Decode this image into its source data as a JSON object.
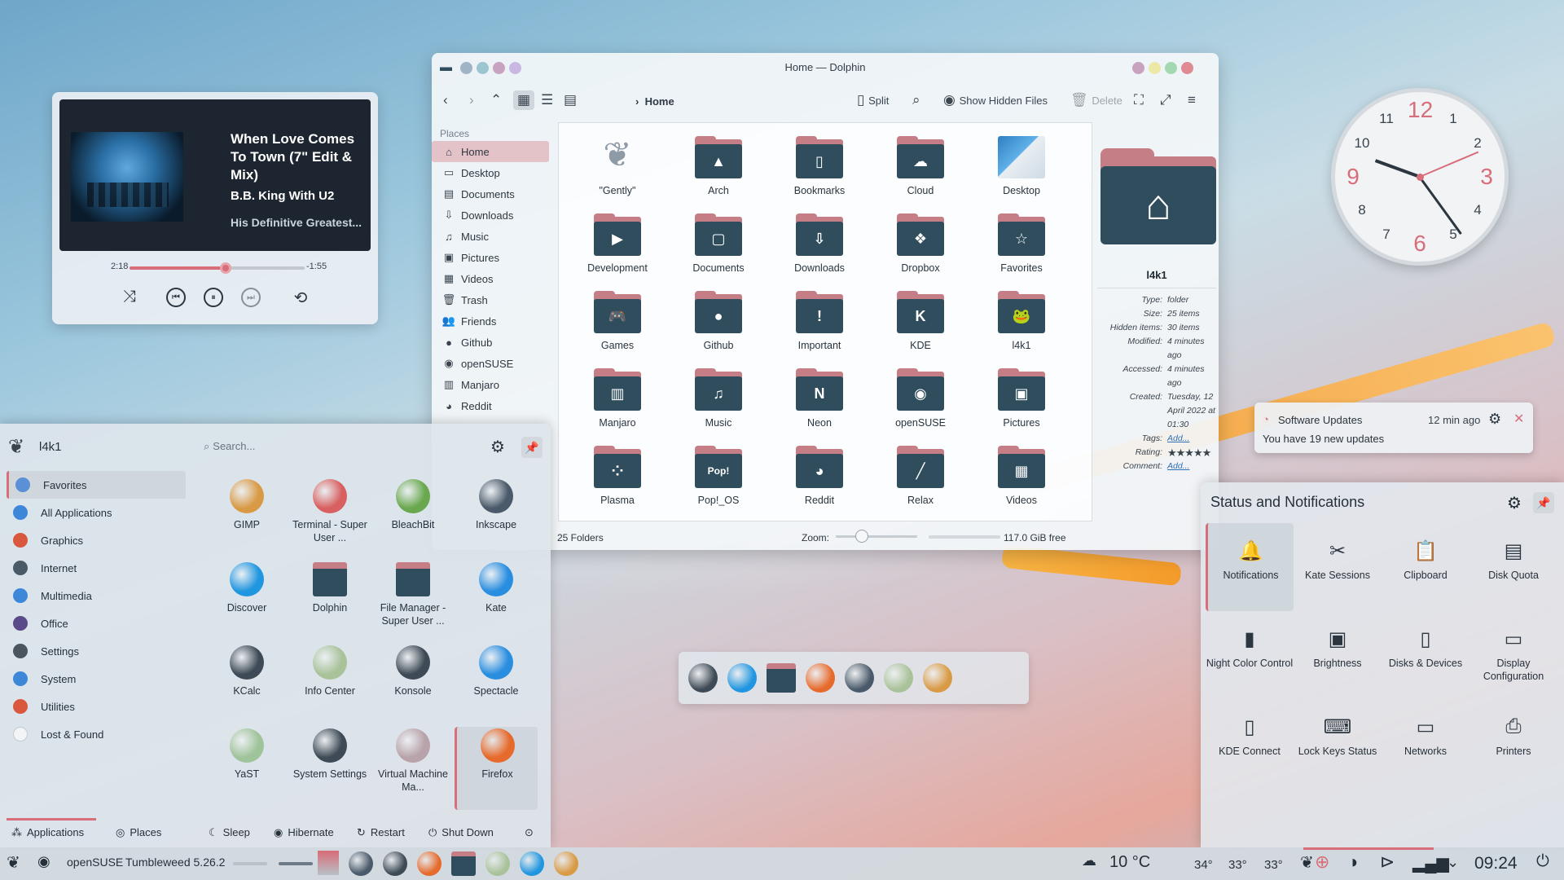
{
  "media": {
    "title": "When Love Comes To Town (7\" Edit & Mix)",
    "artist": "B.B. King With U2",
    "album": "His Definitive Greatest...",
    "elapsed": "2:18",
    "remaining": "-1:55",
    "progress_fraction": 0.55,
    "controls": [
      "shuffle",
      "previous",
      "pause",
      "next",
      "repeat"
    ]
  },
  "dolphin": {
    "window_title": "Home — Dolphin",
    "breadcrumb": "Home",
    "toolbar": {
      "split": "Split",
      "show_hidden": "Show Hidden Files",
      "delete": "Delete"
    },
    "places_header": "Places",
    "places": [
      {
        "label": "Home",
        "icon": "home-icon",
        "glyph": "⌂"
      },
      {
        "label": "Desktop",
        "icon": "desktop-icon",
        "glyph": "▭"
      },
      {
        "label": "Documents",
        "icon": "documents-icon",
        "glyph": "▤"
      },
      {
        "label": "Downloads",
        "icon": "downloads-icon",
        "glyph": "⇩"
      },
      {
        "label": "Music",
        "icon": "music-icon",
        "glyph": "♫"
      },
      {
        "label": "Pictures",
        "icon": "pictures-icon",
        "glyph": "▣"
      },
      {
        "label": "Videos",
        "icon": "videos-icon",
        "glyph": "▦"
      },
      {
        "label": "Trash",
        "icon": "trash-icon",
        "glyph": "🗑"
      },
      {
        "label": "Friends",
        "icon": "friends-icon",
        "glyph": "👥"
      },
      {
        "label": "Github",
        "icon": "github-icon",
        "glyph": "●"
      },
      {
        "label": "openSUSE",
        "icon": "opensuse-icon",
        "glyph": "◉"
      },
      {
        "label": "Manjaro",
        "icon": "manjaro-icon",
        "glyph": "▥"
      },
      {
        "label": "Reddit",
        "icon": "reddit-icon",
        "glyph": "◕"
      }
    ],
    "files": [
      {
        "label": "\"Gently\"",
        "icon": "gently-logo-icon",
        "glyph": "❦",
        "kind": "logo"
      },
      {
        "label": "Arch",
        "icon": "arch-folder-icon",
        "glyph": "▲"
      },
      {
        "label": "Bookmarks",
        "icon": "bookmarks-folder-icon",
        "glyph": "▯"
      },
      {
        "label": "Cloud",
        "icon": "cloud-folder-icon",
        "glyph": "☁"
      },
      {
        "label": "Desktop",
        "icon": "desktop-folder-icon",
        "glyph": "",
        "kind": "desktop"
      },
      {
        "label": "Development",
        "icon": "development-folder-icon",
        "glyph": "▶"
      },
      {
        "label": "Documents",
        "icon": "documents-folder-icon",
        "glyph": "▢"
      },
      {
        "label": "Downloads",
        "icon": "downloads-folder-icon",
        "glyph": "⇩"
      },
      {
        "label": "Dropbox",
        "icon": "dropbox-folder-icon",
        "glyph": "❖"
      },
      {
        "label": "Favorites",
        "icon": "favorites-folder-icon",
        "glyph": "☆"
      },
      {
        "label": "Games",
        "icon": "games-folder-icon",
        "glyph": "🎮"
      },
      {
        "label": "Github",
        "icon": "github-folder-icon",
        "glyph": "●"
      },
      {
        "label": "Important",
        "icon": "important-folder-icon",
        "glyph": "!"
      },
      {
        "label": "KDE",
        "icon": "kde-folder-icon",
        "glyph": "K"
      },
      {
        "label": "l4k1",
        "icon": "l4k1-folder-icon",
        "glyph": "🐸"
      },
      {
        "label": "Manjaro",
        "icon": "manjaro-folder-icon",
        "glyph": "▥"
      },
      {
        "label": "Music",
        "icon": "music-folder-icon",
        "glyph": "♫"
      },
      {
        "label": "Neon",
        "icon": "neon-folder-icon",
        "glyph": "N"
      },
      {
        "label": "openSUSE",
        "icon": "opensuse-folder-icon",
        "glyph": "◉"
      },
      {
        "label": "Pictures",
        "icon": "pictures-folder-icon",
        "glyph": "▣"
      },
      {
        "label": "Plasma",
        "icon": "plasma-folder-icon",
        "glyph": "⁘"
      },
      {
        "label": "Pop!_OS",
        "icon": "popos-folder-icon",
        "glyph": "Pop!"
      },
      {
        "label": "Reddit",
        "icon": "reddit-folder-icon",
        "glyph": "◕"
      },
      {
        "label": "Relax",
        "icon": "relax-folder-icon",
        "glyph": "╱"
      },
      {
        "label": "Videos",
        "icon": "videos-folder-icon",
        "glyph": "▦"
      }
    ],
    "info": {
      "name": "l4k1",
      "rows": [
        {
          "k": "Type:",
          "v": "folder"
        },
        {
          "k": "Size:",
          "v": "25 items"
        },
        {
          "k": "Hidden items:",
          "v": "30 items"
        },
        {
          "k": "Modified:",
          "v": "4 minutes ago"
        },
        {
          "k": "Accessed:",
          "v": "4 minutes ago"
        },
        {
          "k": "Created:",
          "v": "Tuesday, 12 April 2022 at 01:30"
        },
        {
          "k": "Tags:",
          "v": "Add...",
          "link": true
        },
        {
          "k": "Rating:",
          "v": "★★★★★",
          "stars": true
        },
        {
          "k": "Comment:",
          "v": "Add...",
          "link": true
        }
      ]
    },
    "status": {
      "count": "25 Folders",
      "zoom_label": "Zoom:",
      "free": "117.0 GiB free"
    }
  },
  "clock": {
    "numbers": [
      "12",
      "1",
      "2",
      "3",
      "4",
      "5",
      "6",
      "7",
      "8",
      "9",
      "10",
      "11"
    ]
  },
  "notification": {
    "title": "Software Updates",
    "time_ago": "12 min ago",
    "body": "You have 19 new updates"
  },
  "tray": {
    "title": "Status and Notifications",
    "items": [
      {
        "label": "Notifications",
        "icon": "bell-icon",
        "glyph": "🔔",
        "selected": true
      },
      {
        "label": "Kate Sessions",
        "icon": "kate-icon",
        "glyph": "✂"
      },
      {
        "label": "Clipboard",
        "icon": "clipboard-icon",
        "glyph": "📋"
      },
      {
        "label": "Disk Quota",
        "icon": "disk-quota-icon",
        "glyph": "▤"
      },
      {
        "label": "Night Color Control",
        "icon": "night-color-icon",
        "glyph": "▮"
      },
      {
        "label": "Brightness",
        "icon": "brightness-icon",
        "glyph": "▣"
      },
      {
        "label": "Disks & Devices",
        "icon": "disks-icon",
        "glyph": "▯"
      },
      {
        "label": "Display Configuration",
        "icon": "display-icon",
        "glyph": "▭"
      },
      {
        "label": "KDE Connect",
        "icon": "kde-connect-icon",
        "glyph": "▯"
      },
      {
        "label": "Lock Keys Status",
        "icon": "keyboard-icon",
        "glyph": "⌨"
      },
      {
        "label": "Networks",
        "icon": "network-icon",
        "glyph": "▭"
      },
      {
        "label": "Printers",
        "icon": "printer-icon",
        "glyph": "⎙"
      }
    ]
  },
  "launcher": {
    "user": "l4k1",
    "search_placeholder": "Search...",
    "categories": [
      {
        "label": "Favorites",
        "color": "#5b8fd6",
        "selected": true
      },
      {
        "label": "All Applications",
        "color": "#3d87d9"
      },
      {
        "label": "Graphics",
        "color": "#d9573d"
      },
      {
        "label": "Internet",
        "color": "#4a5a66"
      },
      {
        "label": "Multimedia",
        "color": "#3d87d9"
      },
      {
        "label": "Office",
        "color": "#5a4a8a"
      },
      {
        "label": "Settings",
        "color": "#4a5560"
      },
      {
        "label": "System",
        "color": "#3d87d9"
      },
      {
        "label": "Utilities",
        "color": "#d9573d"
      },
      {
        "label": "Lost & Found",
        "color": "#f2f4f6"
      }
    ],
    "apps": [
      {
        "label": "GIMP",
        "icon": "gimp-icon",
        "color": "#d99a45"
      },
      {
        "label": "Terminal - Super User ...",
        "icon": "terminal-su-icon",
        "color": "#d86060"
      },
      {
        "label": "BleachBit",
        "icon": "bleachbit-icon",
        "color": "#6aa84f"
      },
      {
        "label": "Inkscape",
        "icon": "inkscape-icon",
        "color": "#4a5a6a"
      },
      {
        "label": "Discover",
        "icon": "discover-icon",
        "color": "#2196e0"
      },
      {
        "label": "Dolphin",
        "icon": "dolphin-icon",
        "color": "#2f4d5c"
      },
      {
        "label": "File Manager - Super User ...",
        "icon": "file-manager-su-icon",
        "color": "#2f4d5c"
      },
      {
        "label": "Kate",
        "icon": "kate-app-icon",
        "color": "#2a8ee0"
      },
      {
        "label": "KCalc",
        "icon": "kcalc-icon",
        "color": "#3e4a55"
      },
      {
        "label": "Info Center",
        "icon": "info-center-icon",
        "color": "#a9c29a"
      },
      {
        "label": "Konsole",
        "icon": "konsole-icon",
        "color": "#3e4a55"
      },
      {
        "label": "Spectacle",
        "icon": "spectacle-icon",
        "color": "#2a8ee0"
      },
      {
        "label": "YaST",
        "icon": "yast-icon",
        "color": "#9fc39a"
      },
      {
        "label": "System Settings",
        "icon": "system-settings-icon",
        "color": "#3e4a55"
      },
      {
        "label": "Virtual Machine Ma...",
        "icon": "virt-manager-icon",
        "color": "#b7a3a9"
      },
      {
        "label": "Firefox",
        "icon": "firefox-icon",
        "color": "#e66a2b",
        "selected": true
      }
    ],
    "bottom": {
      "applications": "Applications",
      "places": "Places",
      "sleep": "Sleep",
      "hibernate": "Hibernate",
      "restart": "Restart",
      "shutdown": "Shut Down"
    }
  },
  "dock": {
    "items": [
      {
        "icon": "system-settings-icon",
        "color": "#3e4a55"
      },
      {
        "icon": "discover-icon",
        "color": "#2196e0"
      },
      {
        "icon": "dolphin-icon",
        "color": "#2f4d5c"
      },
      {
        "icon": "firefox-icon",
        "color": "#e66a2b"
      },
      {
        "icon": "inkscape-icon",
        "color": "#4a5a6a"
      },
      {
        "icon": "info-center-icon",
        "color": "#a9c29a"
      },
      {
        "icon": "gimp-icon",
        "color": "#d99a45"
      }
    ]
  },
  "taskbar": {
    "distro": "openSUSE",
    "version": "Tumbleweed 5.26.2",
    "temperature": "10 °C",
    "sensors": [
      "34°",
      "33°",
      "33°"
    ],
    "time": "09:24",
    "tasks": [
      {
        "icon": "inkscape-icon",
        "color": "#4a5a6a"
      },
      {
        "icon": "system-settings-icon",
        "color": "#3e4a55"
      },
      {
        "icon": "firefox-icon",
        "color": "#e66a2b"
      },
      {
        "icon": "dolphin-icon",
        "color": "#2f4d5c"
      },
      {
        "icon": "info-center-icon",
        "color": "#a9c29a"
      },
      {
        "icon": "discover-icon",
        "color": "#2196e0"
      },
      {
        "icon": "gimp-icon",
        "color": "#d99a45"
      }
    ]
  }
}
